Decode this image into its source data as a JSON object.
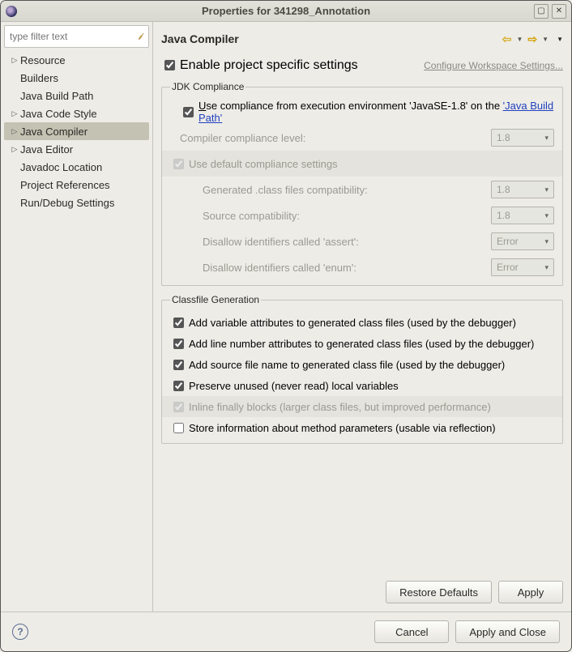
{
  "window": {
    "title": "Properties for 341298_Annotation"
  },
  "sidebar": {
    "filter_placeholder": "type filter text",
    "items": [
      {
        "label": "Resource",
        "expandable": true
      },
      {
        "label": "Builders",
        "expandable": false
      },
      {
        "label": "Java Build Path",
        "expandable": false
      },
      {
        "label": "Java Code Style",
        "expandable": true
      },
      {
        "label": "Java Compiler",
        "expandable": true,
        "selected": true
      },
      {
        "label": "Java Editor",
        "expandable": true
      },
      {
        "label": "Javadoc Location",
        "expandable": false
      },
      {
        "label": "Project References",
        "expandable": false
      },
      {
        "label": "Run/Debug Settings",
        "expandable": false
      }
    ]
  },
  "page": {
    "title": "Java Compiler",
    "enable_project_specific": "Enable project specific settings",
    "configure_link": "Configure Workspace Settings...",
    "jdk": {
      "legend": "JDK Compliance",
      "use_env_prefix": "se compliance from execution environment 'JavaSE-1.8' on the ",
      "use_env_char": "U",
      "build_path_link": "'Java Build Path'",
      "compliance_level_label": "Compiler compliance level:",
      "compliance_level_value": "1.8",
      "use_default_label": "Use default compliance settings",
      "generated_files_label": "Generated .class files compatibility:",
      "generated_files_value": "1.8",
      "source_compat_label": "Source compatibility:",
      "source_compat_value": "1.8",
      "disallow_assert_label": "Disallow identifiers called 'assert':",
      "disallow_assert_value": "Error",
      "disallow_enum_label": "Disallow identifiers called 'enum':",
      "disallow_enum_value": "Error"
    },
    "classfile": {
      "legend": "Classfile Generation",
      "opt1": "Add variable attributes to generated class files (used by the debugger)",
      "opt2": "Add line number attributes to generated class files (used by the debugger)",
      "opt3": "Add source file name to generated class file (used by the debugger)",
      "opt4": "Preserve unused (never read) local variables",
      "opt5": "Inline finally blocks (larger class files, but improved performance)",
      "opt6": "Store information about method parameters (usable via reflection)"
    },
    "buttons": {
      "restore": "Restore Defaults",
      "apply": "Apply",
      "cancel": "Cancel",
      "apply_close": "Apply and Close"
    }
  }
}
